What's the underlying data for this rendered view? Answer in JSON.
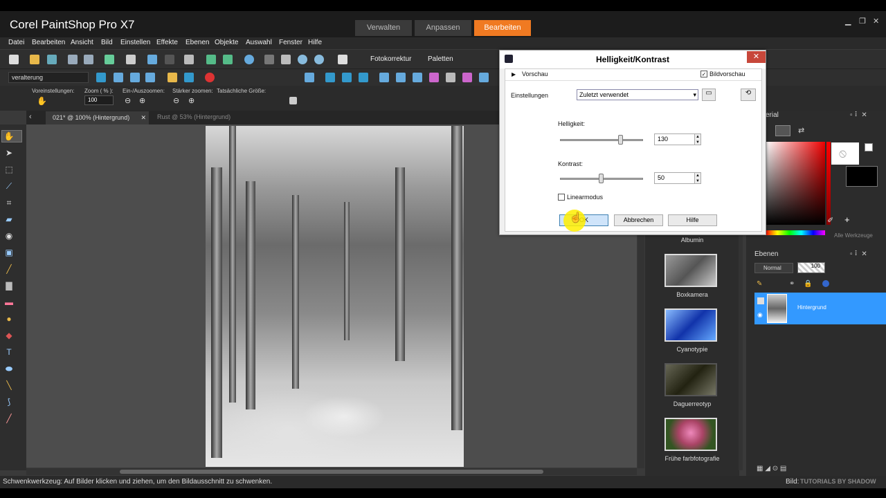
{
  "app": {
    "title": "Corel PaintShop Pro X7"
  },
  "workspace_tabs": [
    {
      "label": "Verwalten"
    },
    {
      "label": "Anpassen"
    },
    {
      "label": "Bearbeiten"
    }
  ],
  "menu": [
    "Datei",
    "Bearbeiten",
    "Ansicht",
    "Bild",
    "Einstellen",
    "Effekte",
    "Ebenen",
    "Objekte",
    "Auswahl",
    "Fenster",
    "Hilfe"
  ],
  "toolbar": {
    "fotokorrektur": "Fotokorrektur",
    "paletten": "Paletten"
  },
  "toolbar2": {
    "preset_value": "veralterung"
  },
  "tool_options": {
    "voreinstellungen": "Voreinstellungen:",
    "zoom_label": "Zoom ( % ):",
    "zoom_value": "100",
    "einaus": "Ein-/Auszoomen:",
    "staerker": "Stärker zoomen:",
    "tatsaechlich": "Tatsächliche Größe:"
  },
  "doc_tabs": [
    {
      "label": "021* @ 100% (Hintergrund)"
    },
    {
      "label": "Rust @  53% (Hintergrund)"
    }
  ],
  "dialog": {
    "title": "Helligkeit/Kontrast",
    "vorschau": "Vorschau",
    "bildvorschau": "Bildvorschau",
    "einstellungen_label": "Einstellungen",
    "einstellungen_value": "Zuletzt verwendet",
    "helligkeit_label": "Helligkeit:",
    "helligkeit_value": "130",
    "kontrast_label": "Kontrast:",
    "kontrast_value": "50",
    "linearmodus": "Linearmodus",
    "ok": "OK",
    "abbrechen": "Abbrechen",
    "hilfe": "Hilfe"
  },
  "effects": [
    {
      "label": "Albumin"
    },
    {
      "label": "Boxkamera"
    },
    {
      "label": "Cyanotypie"
    },
    {
      "label": "Daguerreotyp"
    },
    {
      "label": "Frühe farbfotografie"
    }
  ],
  "material_panel": {
    "title": "erial",
    "alle_werkzeuge": "Alle Werkzeuge"
  },
  "layers_panel": {
    "title": "Ebenen",
    "blend": "Normal",
    "opacity": "100",
    "layer_name": "Hintergrund"
  },
  "status": {
    "text": "Schwenkwerkzeug: Auf Bilder klicken und ziehen, um den Bildausschnitt zu schwenken.",
    "right": "Bild:",
    "watermark": "TUTORIALS BY SHADOW"
  },
  "colors": {
    "accent": "#f07a22",
    "layer_selected": "#3399ff",
    "highlight": "#ffee00"
  }
}
